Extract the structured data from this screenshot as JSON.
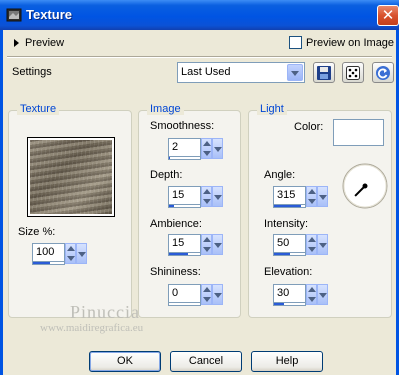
{
  "window": {
    "title": "Texture",
    "icon": "psp-app-icon",
    "close_icon": "close-icon"
  },
  "preview": {
    "label": "Preview",
    "preview_on_image_label": "Preview on Image",
    "preview_on_image_checked": false
  },
  "settings": {
    "label": "Settings",
    "selected": "Last Used",
    "buttons": [
      "save-preset-icon",
      "randomize-icon",
      "reset-icon"
    ]
  },
  "texture": {
    "group_title": "Texture",
    "size_label": "Size %:",
    "size": {
      "value": "100",
      "fill_fraction": 0.55
    }
  },
  "image": {
    "group_title": "Image",
    "smoothness": {
      "label": "Smoothness:",
      "value": "2",
      "fill_fraction": 0.02
    },
    "depth": {
      "label": "Depth:",
      "value": "15",
      "fill_fraction": 0.15
    },
    "ambience": {
      "label": "Ambience:",
      "value": "15",
      "fill_fraction": 0.6
    },
    "shininess": {
      "label": "Shininess:",
      "value": "0",
      "fill_fraction": 0.0
    }
  },
  "light": {
    "group_title": "Light",
    "color_label": "Color:",
    "color_value": "#ffffff",
    "angle": {
      "label": "Angle:",
      "value": "315",
      "fill_fraction": 0.875
    },
    "intensity": {
      "label": "Intensity:",
      "value": "50",
      "fill_fraction": 0.5
    },
    "elevation": {
      "label": "Elevation:",
      "value": "30",
      "fill_fraction": 0.33
    }
  },
  "watermark": {
    "name": "Pinuccia",
    "url": "www.maidiregrafica.eu"
  },
  "footer": {
    "ok": "OK",
    "cancel": "Cancel",
    "help": "Help"
  },
  "colors": {
    "title_blue": "#0054e3",
    "group_title": "#0046d5",
    "dialog_bg": "#ece9d8",
    "slider_fill": "#2a5bd7"
  }
}
